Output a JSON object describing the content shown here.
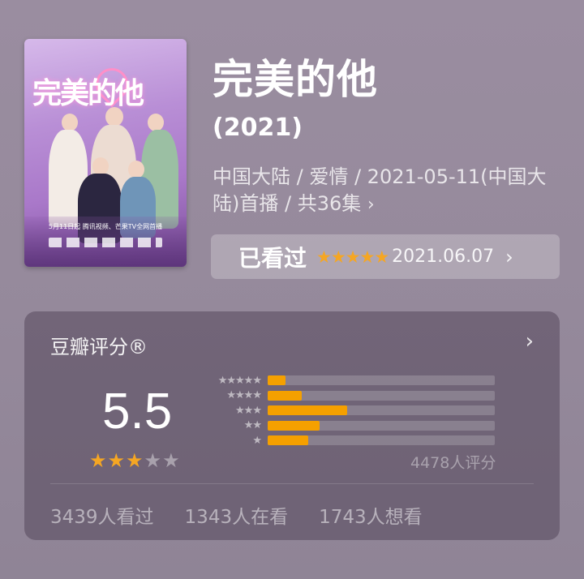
{
  "movie": {
    "title": "完美的他",
    "year": "(2021)",
    "meta": "中国大陆 / 爱情 / 2021-05-11(中国大陆)首播 / 共36集",
    "meta_chevron": "›",
    "poster": {
      "title_text": "完美的他",
      "caption": "5月11日起 腾讯视频、芒果TV全网首播"
    }
  },
  "watched": {
    "label": "已看过",
    "user_stars": 5,
    "stars_text": "★★★★★",
    "date": "2021.06.07",
    "chevron": "›"
  },
  "rating": {
    "title": "豆瓣评分®",
    "chevron": "›",
    "score": "5.5",
    "stars_on": "★★★",
    "stars_off": "★★",
    "distribution": [
      {
        "stars_label": "★★★★★",
        "fraction": 0.08
      },
      {
        "stars_label": "★★★★",
        "fraction": 0.15
      },
      {
        "stars_label": "★★★",
        "fraction": 0.35
      },
      {
        "stars_label": "★★",
        "fraction": 0.23
      },
      {
        "stars_label": "★",
        "fraction": 0.18
      }
    ],
    "count": "4478人评分"
  },
  "stats": {
    "watched": "3439人看过",
    "watching": "1343人在看",
    "want": "1743人想看"
  },
  "colors": {
    "accent_star": "#f5a623",
    "bar_fill": "#f5a000",
    "background": "#968a9c"
  }
}
